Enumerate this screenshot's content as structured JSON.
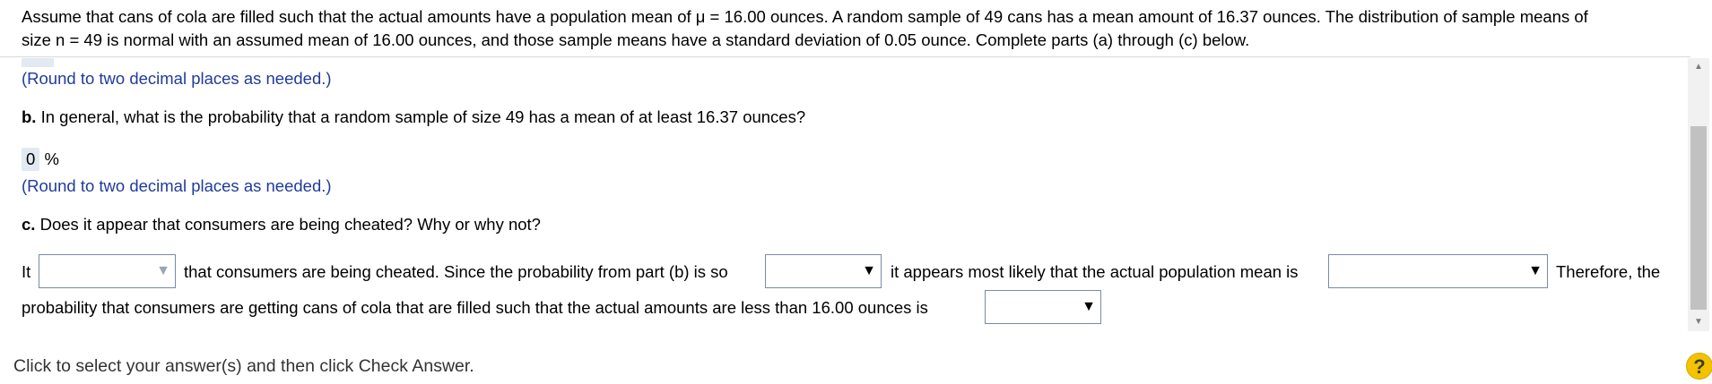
{
  "question": {
    "line1": "Assume that cans of cola are filled such that the actual amounts have a population mean of μ = 16.00 ounces. A random sample of 49 cans has a mean amount of 16.37 ounces. The distribution of sample means of",
    "line2": "size n = 49 is normal with an assumed mean of 16.00 ounces, and those sample means have a standard deviation of 0.05 ounce. Complete parts (a) through (c) below."
  },
  "part_a": {
    "round_hint": "(Round to two decimal places as needed.)"
  },
  "part_b": {
    "label": "b.",
    "question": "In general, what is the probability that a random sample of size 49 has a mean of at least 16.37 ounces?",
    "answer_value": "0",
    "answer_unit": "%",
    "round_hint": "(Round to two decimal places as needed.)"
  },
  "part_c": {
    "label": "c.",
    "question": "Does it appear that consumers are being cheated? Why or why not?",
    "text_it": "It",
    "text_cheated": "that consumers are being cheated. Since the probability from part (b) is so",
    "text_appears": "it appears most likely that the actual population mean is",
    "text_therefore": "Therefore, the",
    "text_line2": "probability that consumers are getting cans of cola that are filled such that the actual amounts are less than 16.00 ounces is",
    "dropdown_arrow": "▼"
  },
  "scrollbar": {
    "up_arrow": "▲",
    "down_arrow": "▼"
  },
  "footer": {
    "instruction": "Click to select your answer(s) and then click Check Answer."
  },
  "help": {
    "label": "?"
  },
  "colors": {
    "hint": "#1f3b9a",
    "chip": "#e3e9f1",
    "help_bg": "#f3c300"
  }
}
